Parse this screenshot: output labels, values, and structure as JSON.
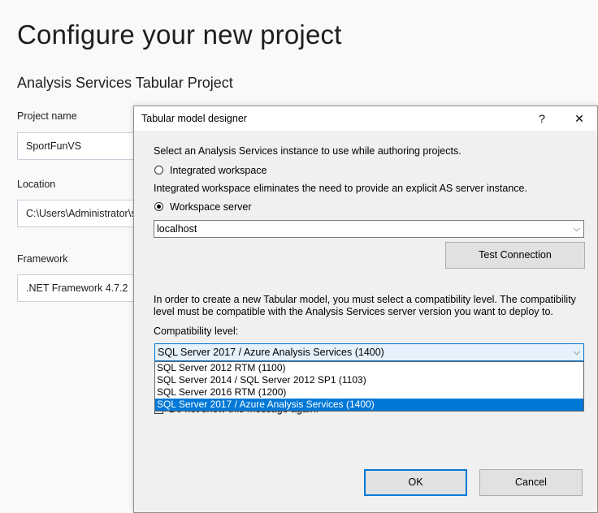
{
  "page": {
    "title": "Configure your new project",
    "subtitle": "Analysis Services Tabular Project",
    "project_name_label": "Project name",
    "project_name_value": "SportFunVS",
    "location_label": "Location",
    "location_value": "C:\\Users\\Administrator\\so",
    "framework_label": "Framework",
    "framework_value": ".NET Framework 4.7.2"
  },
  "dialog": {
    "title": "Tabular model designer",
    "help_glyph": "?",
    "close_glyph": "✕",
    "intro": "Select an Analysis Services instance to use while authoring projects.",
    "integrated_label": "Integrated workspace",
    "integrated_selected": false,
    "integrated_note": "Integrated workspace eliminates the need to provide an explicit AS server instance.",
    "workspace_label": "Workspace server",
    "workspace_selected": true,
    "server_value": "localhost",
    "test_connection_label": "Test Connection",
    "compat_text_1": "In order to create a new Tabular model, you must select a compatibility level. The compatibility",
    "compat_text_2": "level must be compatible with the Analysis Services server version you want to deploy to.",
    "compat_label": "Compatibility level:",
    "compat_selected": "SQL Server 2017 / Azure Analysis Services (1400)",
    "compat_options": [
      "SQL Server 2012 RTM (1100)",
      "SQL Server 2014 / SQL Server 2012 SP1 (1103)",
      "SQL Server 2016 RTM (1200)",
      "SQL Server 2017 / Azure Analysis Services (1400)"
    ],
    "dont_show_label": "Do not show this message again.",
    "ok_label": "OK",
    "cancel_label": "Cancel"
  },
  "icons": {
    "chevron": "chevron-down-icon"
  },
  "colors": {
    "accent": "#0078d7",
    "dialog_bg": "#f0f0f0",
    "page_bg": "#f9f9f9"
  }
}
